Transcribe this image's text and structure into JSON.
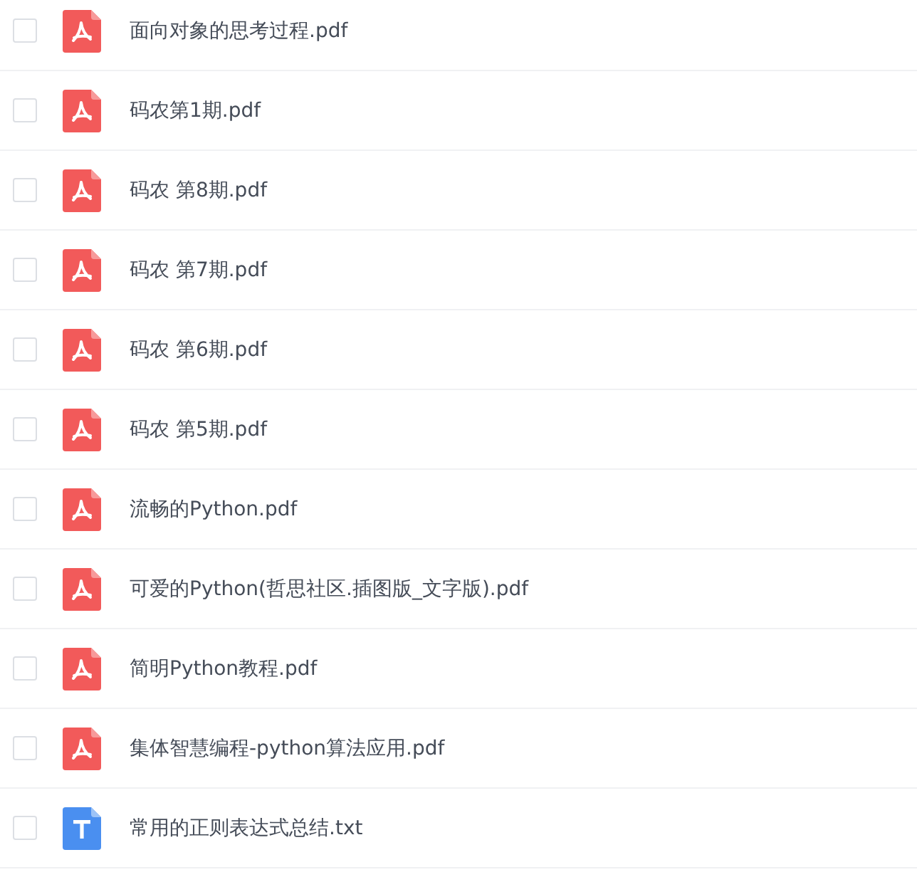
{
  "files": [
    {
      "name": "面向对象的思考过程.pdf",
      "kind": "pdf",
      "checked": false
    },
    {
      "name": "码农第1期.pdf",
      "kind": "pdf",
      "checked": false
    },
    {
      "name": "码农 第8期.pdf",
      "kind": "pdf",
      "checked": false
    },
    {
      "name": "码农 第7期.pdf",
      "kind": "pdf",
      "checked": false
    },
    {
      "name": "码农 第6期.pdf",
      "kind": "pdf",
      "checked": false
    },
    {
      "name": "码农 第5期.pdf",
      "kind": "pdf",
      "checked": false
    },
    {
      "name": "流畅的Python.pdf",
      "kind": "pdf",
      "checked": false
    },
    {
      "name": "可爱的Python(哲思社区.插图版_文字版).pdf",
      "kind": "pdf",
      "checked": false
    },
    {
      "name": "简明Python教程.pdf",
      "kind": "pdf",
      "checked": false
    },
    {
      "name": "集体智慧编程-python算法应用.pdf",
      "kind": "pdf",
      "checked": false
    },
    {
      "name": "常用的正则表达式总结.txt",
      "kind": "txt",
      "checked": false
    }
  ]
}
